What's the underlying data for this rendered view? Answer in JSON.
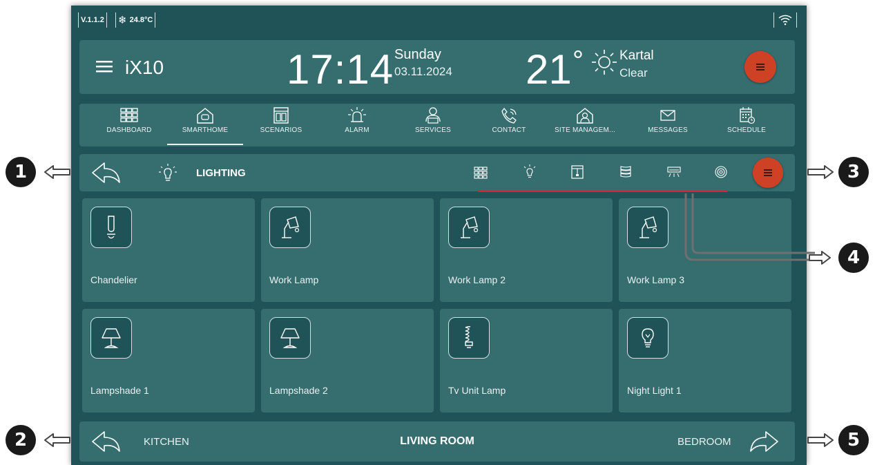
{
  "status": {
    "version": "V.1.1.2",
    "temperature": "24.8°C"
  },
  "header": {
    "app_name": "iX10",
    "time": "17:14",
    "day": "Sunday",
    "date": "03.11.2024",
    "temp": "21",
    "degree": "°",
    "city": "Kartal",
    "condition": "Clear"
  },
  "nav": {
    "items": [
      {
        "label": "DASHBOARD",
        "icon": "dashboard-icon"
      },
      {
        "label": "SMARTHOME",
        "icon": "home-icon",
        "active": true
      },
      {
        "label": "SCENARIOS",
        "icon": "scenarios-icon"
      },
      {
        "label": "ALARM",
        "icon": "alarm-icon"
      },
      {
        "label": "SERVICES",
        "icon": "services-icon"
      },
      {
        "label": "CONTACT",
        "icon": "phone-icon"
      },
      {
        "label": "SITE MANAGEM...",
        "icon": "site-management-icon"
      },
      {
        "label": "MESSAGES",
        "icon": "mail-icon"
      },
      {
        "label": "SCHEDULE",
        "icon": "calendar-icon"
      }
    ]
  },
  "toolbar": {
    "title": "LIGHTING",
    "category_icons": [
      "grid-icon",
      "bulb-icon",
      "curtain-icon",
      "blinds-icon",
      "ac-icon",
      "sensor-icon"
    ]
  },
  "devices": [
    {
      "label": "Chandelier",
      "icon": "chandelier-icon"
    },
    {
      "label": "Work Lamp",
      "icon": "desk-lamp-icon"
    },
    {
      "label": "Work Lamp 2",
      "icon": "desk-lamp-icon"
    },
    {
      "label": "Work Lamp 3",
      "icon": "desk-lamp-icon"
    },
    {
      "label": "Lampshade 1",
      "icon": "lampshade-icon"
    },
    {
      "label": "Lampshade 2",
      "icon": "lampshade-icon"
    },
    {
      "label": "Tv Unit Lamp",
      "icon": "spiral-bulb-icon"
    },
    {
      "label": "Night Light 1",
      "icon": "bulb-icon"
    }
  ],
  "rooms": {
    "prev": "KITCHEN",
    "current": "LIVING ROOM",
    "next": "BEDROOM"
  },
  "callouts": [
    "1",
    "2",
    "3",
    "4",
    "5"
  ],
  "colors": {
    "background": "#1f5357",
    "card": "#366e70",
    "accent": "#cf4125",
    "highlight_line": "#d4253a"
  }
}
